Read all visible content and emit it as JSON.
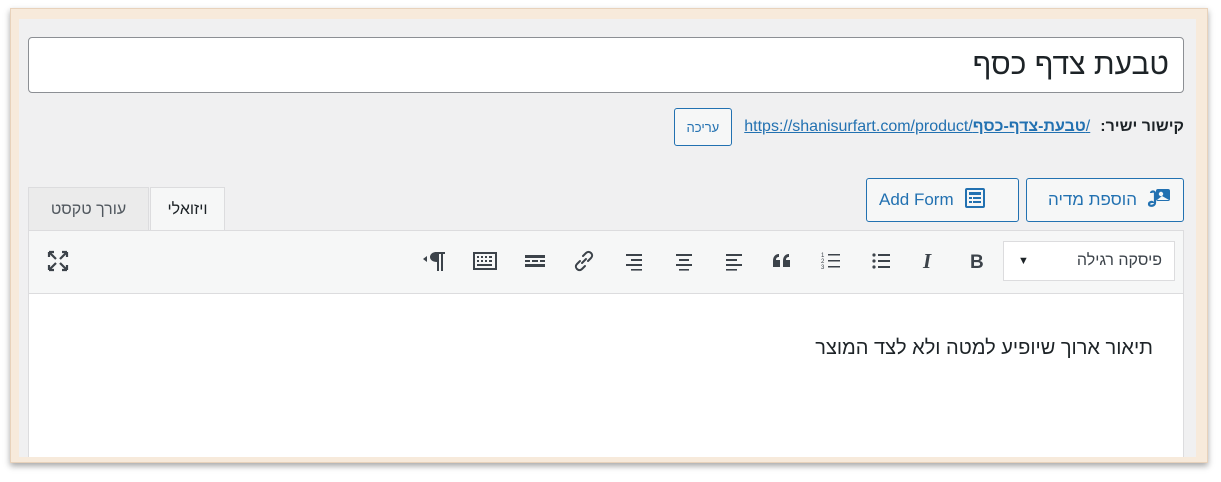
{
  "post": {
    "title": "טבעת צדף כסף"
  },
  "permalink": {
    "label": "קישור ישיר:",
    "url_base": "https://shanisurfart.com/product/",
    "slug": "טבעת-צדף-כסף",
    "url_tail": "/",
    "edit_label": "עריכה"
  },
  "media_buttons": {
    "add_media": "הוספת מדיה",
    "add_form": "Add Form"
  },
  "tabs": {
    "visual": "ויזואלי",
    "text": "עורך טקסט"
  },
  "toolbar": {
    "format_select": "פיסקה רגילה",
    "buttons": [
      "bold",
      "italic",
      "bulleted-list",
      "numbered-list",
      "blockquote",
      "align-left",
      "align-center",
      "align-right",
      "insert-link",
      "read-more",
      "toolbar-toggle",
      "paragraph-rtl",
      "fullscreen"
    ]
  },
  "editor": {
    "content": "תיאור ארוך שיופיע למטה ולא לצד המוצר"
  },
  "colors": {
    "accent": "#2271b1",
    "frame": "#f7eadb",
    "panel": "#f0f0f1"
  }
}
